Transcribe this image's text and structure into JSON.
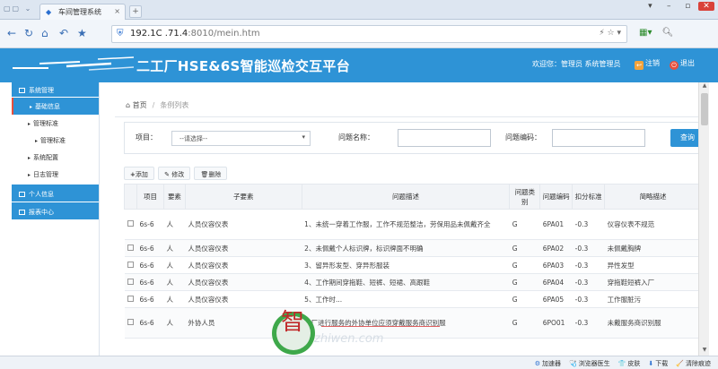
{
  "browser": {
    "tab_title": "车间管理系统",
    "url_host": "192.1C",
    "url_mid": "  .71.4",
    "url_path": ":8010/mein.htm"
  },
  "app": {
    "title": "二工厂HSE&6S智能巡检交互平台",
    "welcome": "欢迎您：管理员 系统管理员",
    "logout": "注销",
    "exit": "退出"
  },
  "sidebar": {
    "groups": [
      {
        "label": "系统管理"
      },
      {
        "label": "个人信息"
      },
      {
        "label": "报表中心"
      }
    ],
    "items": [
      {
        "label": "基础信息"
      },
      {
        "label": "管理标准"
      },
      {
        "label": "管理标准"
      },
      {
        "label": "系统配置"
      },
      {
        "label": "日志管理"
      }
    ]
  },
  "breadcrumb": {
    "home": "首页",
    "sep": "/",
    "current": "条例列表"
  },
  "filter": {
    "item_label": "项目：",
    "item_value": "--请选择--",
    "name_label": "问题名称：",
    "code_label": "问题编码：",
    "query_button": "查询"
  },
  "toolbar": {
    "add": "添加",
    "edit": "修改",
    "delete": "删除"
  },
  "table": {
    "headers": [
      "项目",
      "要素",
      "子要素",
      "问题描述",
      "问题类别",
      "问题编码",
      "扣分标准",
      "简略描述"
    ],
    "rows": [
      [
        "6s-6",
        "人",
        "人员仪容仪表",
        "1、未统一穿着工作服，工作不规范整洁，劳保用品未佩戴齐全",
        "G",
        "6PA01",
        "-0.3",
        "仪容仪表不规范"
      ],
      [
        "6s-6",
        "人",
        "人员仪容仪表",
        "2、未佩戴个人标识牌，标识牌面不明确",
        "G",
        "6PA02",
        "-0.3",
        "未佩戴胸牌"
      ],
      [
        "6s-6",
        "人",
        "人员仪容仪表",
        "3、留异形发型、穿异形服装",
        "G",
        "6PA03",
        "-0.3",
        "异性发型"
      ],
      [
        "6s-6",
        "人",
        "人员仪容仪表",
        "4、工作期间穿拖鞋、短裤、短裙、高跟鞋",
        "G",
        "6PA04",
        "-0.3",
        "穿拖鞋短裤入厂"
      ],
      [
        "6s-6",
        "人",
        "人员仪容仪表",
        "5、工作时...",
        "G",
        "6PA05",
        "-0.3",
        "工作服脏污"
      ],
      [
        "6s-6",
        "人",
        "外协人员",
        "入厂进行服务的外协单位应须穿戴服务商识别服",
        "G",
        "6PO01",
        "-0.3",
        "未戴服务商识别服"
      ]
    ]
  },
  "statusbar": {
    "items": [
      "加速器",
      "浏览器医生",
      "皮肤",
      "下载",
      "清除痕迹"
    ]
  },
  "watermark": {
    "char": "智",
    "text": "zhiwen.com"
  }
}
